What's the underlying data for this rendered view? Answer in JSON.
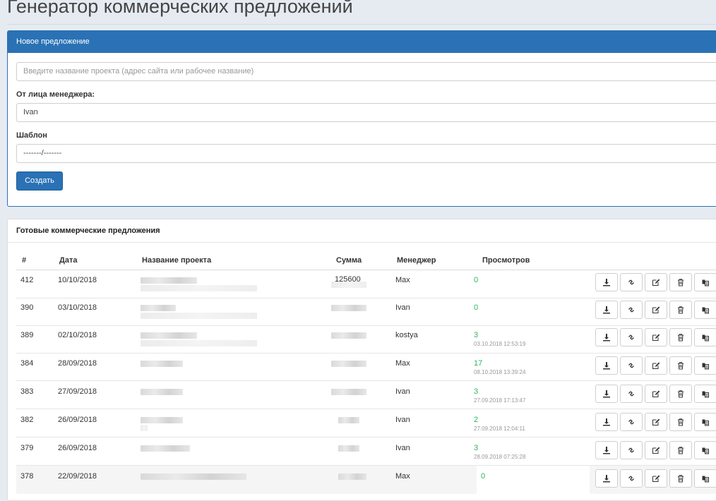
{
  "page": {
    "title": "Генератор коммерческих предложений"
  },
  "new_offer": {
    "panel_title": "Новое предложение",
    "project_placeholder": "Введите название проекта (адрес сайта или рабочее название)",
    "manager_label": "От лица менеджера:",
    "manager_value": "Ivan",
    "template_label": "Шаблон",
    "template_value": "-------/-------",
    "create_label": "Создать"
  },
  "offers": {
    "panel_title": "Готовые коммерческие предложения",
    "columns": [
      "#",
      "Дата",
      "Название проекта",
      "Сумма",
      "Менеджер",
      "Просмотров"
    ],
    "rows": [
      {
        "id": "412",
        "date": "10/10/2018",
        "sum": "125600",
        "manager": "Max",
        "views": "0",
        "last_view": ""
      },
      {
        "id": "390",
        "date": "03/10/2018",
        "sum": "",
        "manager": "Ivan",
        "views": "0",
        "last_view": ""
      },
      {
        "id": "389",
        "date": "02/10/2018",
        "sum": "",
        "manager": "kostya",
        "views": "3",
        "last_view": "03.10.2018 12:53:19"
      },
      {
        "id": "384",
        "date": "28/09/2018",
        "sum": "",
        "manager": "Max",
        "views": "17",
        "last_view": "08.10.2018 13:39:24"
      },
      {
        "id": "383",
        "date": "27/09/2018",
        "sum": "",
        "manager": "Ivan",
        "views": "3",
        "last_view": "27.09.2018 17:13:47"
      },
      {
        "id": "382",
        "date": "26/09/2018",
        "sum": "",
        "manager": "Ivan",
        "views": "2",
        "last_view": "27.09.2018 12:04:11"
      },
      {
        "id": "379",
        "date": "26/09/2018",
        "sum": "",
        "manager": "Ivan",
        "views": "3",
        "last_view": "28.09.2018 07:25:28"
      },
      {
        "id": "378",
        "date": "22/09/2018",
        "sum": "",
        "manager": "Max",
        "views": "0",
        "last_view": ""
      }
    ],
    "action_icons": [
      "download-icon",
      "link-icon",
      "edit-icon",
      "trash-icon",
      "copy-icon"
    ]
  },
  "colors": {
    "primary": "#2a72b5",
    "views_green": "#2bb55c",
    "page_bg": "#e6ebf2"
  }
}
